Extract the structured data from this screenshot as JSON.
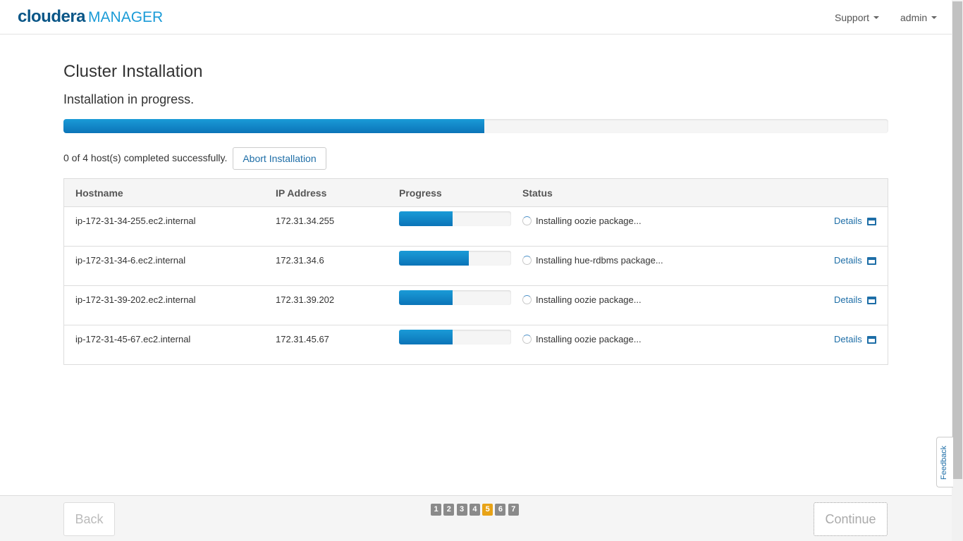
{
  "brand": {
    "name": "cloudera",
    "product": "MANAGER"
  },
  "nav": {
    "support": "Support",
    "user": "admin"
  },
  "page": {
    "title": "Cluster Installation",
    "subtitle": "Installation in progress.",
    "overall_progress_percent": 51,
    "host_summary": "0 of 4 host(s) completed successfully.",
    "abort_label": "Abort Installation"
  },
  "table": {
    "headers": {
      "hostname": "Hostname",
      "ip": "IP Address",
      "progress": "Progress",
      "status": "Status"
    },
    "rows": [
      {
        "hostname": "ip-172-31-34-255.ec2.internal",
        "ip": "172.31.34.255",
        "progress_percent": 48,
        "status": "Installing oozie package...",
        "details": "Details"
      },
      {
        "hostname": "ip-172-31-34-6.ec2.internal",
        "ip": "172.31.34.6",
        "progress_percent": 62,
        "status": "Installing hue-rdbms package...",
        "details": "Details"
      },
      {
        "hostname": "ip-172-31-39-202.ec2.internal",
        "ip": "172.31.39.202",
        "progress_percent": 48,
        "status": "Installing oozie package...",
        "details": "Details"
      },
      {
        "hostname": "ip-172-31-45-67.ec2.internal",
        "ip": "172.31.45.67",
        "progress_percent": 48,
        "status": "Installing oozie package...",
        "details": "Details"
      }
    ]
  },
  "feedback": "Feedback",
  "footer": {
    "back_label": "Back",
    "continue_label": "Continue",
    "steps": [
      "1",
      "2",
      "3",
      "4",
      "5",
      "6",
      "7"
    ],
    "active_step": "5"
  },
  "colors": {
    "brand_dark": "#0a5687",
    "brand_light": "#1a9bd7",
    "progress": "#0b74b8",
    "active_step": "#e8a317",
    "link": "#1e6ea7"
  },
  "icons": {
    "caret": "caret-down-icon",
    "spinner": "spinner-icon",
    "details": "window-icon"
  }
}
